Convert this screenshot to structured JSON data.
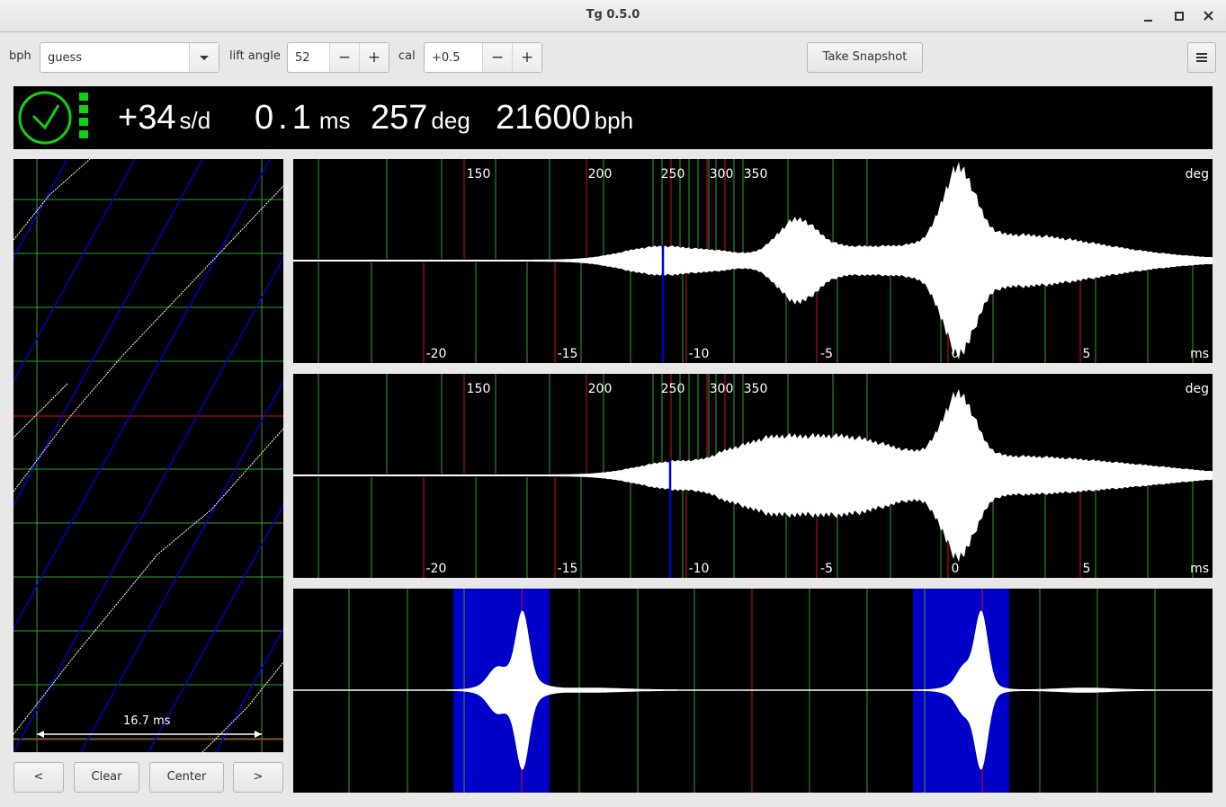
{
  "window": {
    "title": "Tg 0.5.0",
    "minimize": "_",
    "maximize": "□",
    "close": "✕"
  },
  "toolbar": {
    "bph_label": "bph",
    "bph_value": "guess",
    "lift_angle_label": "lift angle",
    "lift_angle_value": "52",
    "cal_label": "cal",
    "cal_value": "+0.5",
    "minus": "−",
    "plus": "+",
    "snapshot_label": "Take Snapshot",
    "menu_icon": "≡"
  },
  "status": {
    "rate_value": "+34",
    "rate_unit": "s/d",
    "beat_error_value": "0.1",
    "beat_error_unit": "ms",
    "amplitude_value": "257",
    "amplitude_unit": "deg",
    "bph_value": "21600",
    "bph_unit": "bph"
  },
  "paperstrip": {
    "scale_label": "16.7 ms"
  },
  "waveforms": {
    "deg_labels": [
      "150",
      "200",
      "250",
      "300",
      "350"
    ],
    "deg_unit": "deg",
    "ms_labels": [
      "-20",
      "-15",
      "-10",
      "-5",
      "0",
      "5"
    ],
    "ms_unit": "ms"
  },
  "controls": {
    "prev": "<",
    "clear": "Clear",
    "center": "Center",
    "next": ">"
  },
  "colors": {
    "grid": "#2fa12f",
    "marker": "#d01010",
    "highlight": "#0000c8",
    "ok": "#12d012"
  }
}
